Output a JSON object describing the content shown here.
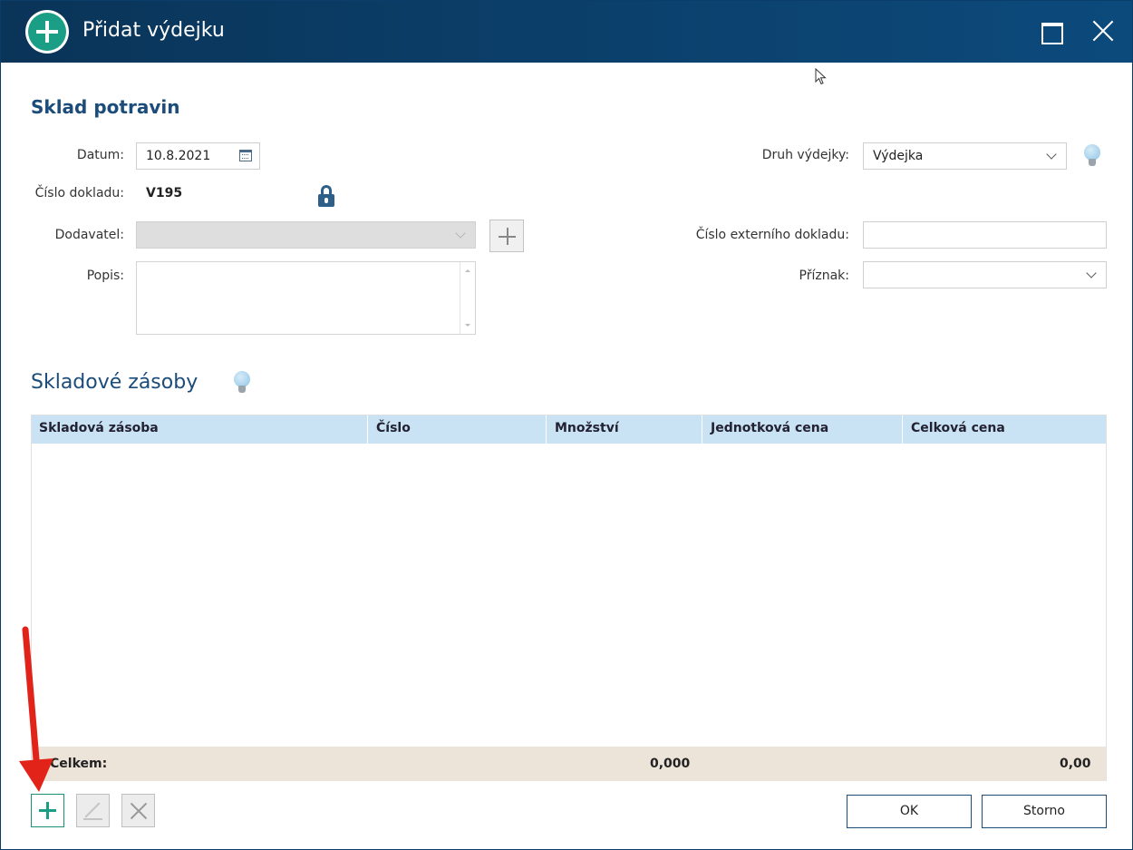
{
  "window": {
    "title": "Přidat výdejku",
    "maximize_icon": "maximize-icon",
    "close_icon": "close-icon",
    "accent_color": "#1a9e86",
    "titlebar_color": "#0a3458"
  },
  "form": {
    "section_title": "Sklad potravin",
    "datum_label": "Datum:",
    "datum_value": "10.8.2021",
    "cislo_label": "Číslo dokladu:",
    "cislo_value": "V195",
    "dodavatel_label": "Dodavatel:",
    "dodavatel_value": "",
    "popis_label": "Popis:",
    "popis_value": "",
    "druh_label": "Druh výdejky:",
    "druh_value": "Výdejka",
    "externi_label": "Číslo externího dokladu:",
    "externi_value": "",
    "priznak_label": "Příznak:",
    "priznak_value": ""
  },
  "stock": {
    "title": "Skladové zásoby",
    "columns": [
      "Skladová zásoba",
      "Číslo",
      "Množství",
      "Jednotková cena",
      "Celková cena"
    ],
    "rows": [],
    "footer_label": "Celkem:",
    "total_quantity": "0,000",
    "total_price": "0,00"
  },
  "actions": {
    "ok": "OK",
    "cancel": "Storno"
  }
}
